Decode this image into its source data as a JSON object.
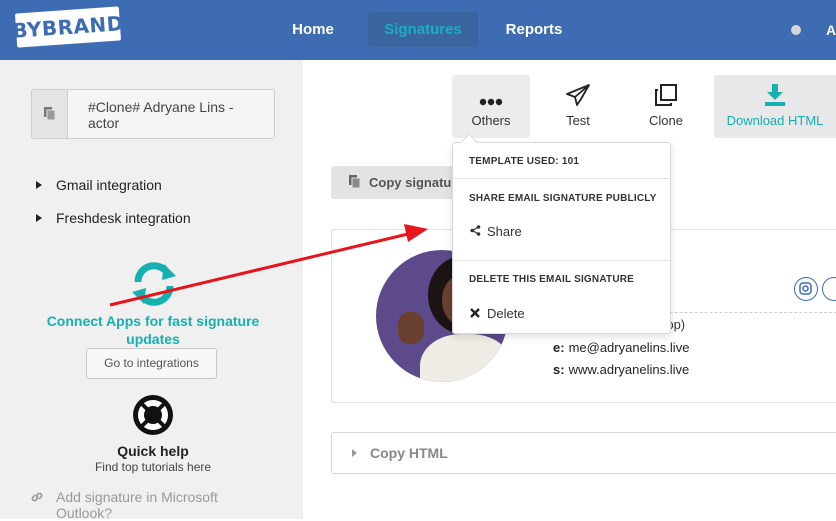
{
  "header": {
    "logo": "BYBRAND",
    "nav": [
      "Home",
      "Signatures",
      "Reports"
    ],
    "user_initial": "A"
  },
  "sidebar": {
    "selected_signature": "#Clone# Adryane Lins - actor",
    "integrations": [
      "Gmail integration",
      "Freshdesk integration"
    ],
    "connect_text": "Connect Apps for fast signature updates",
    "goto_button": "Go to integrations",
    "help_title": "Quick help",
    "help_sub": "Find top tutorials here",
    "outlook_text": "Add signature in Microsoft Outlook?"
  },
  "toolbar": {
    "others": "Others",
    "test": "Test",
    "clone": "Clone",
    "download": "Download HTML"
  },
  "main": {
    "copy_button": "Copy signature",
    "whatsapp_fragment": "tsapp)",
    "email_label": "e:",
    "email": "me@adryanelins.live",
    "site_label": "s:",
    "site": "www.adryanelins.live",
    "copy_html": "Copy HTML"
  },
  "dropdown": {
    "template_used": "TEMPLATE USED: 101",
    "share_heading": "SHARE EMAIL SIGNATURE PUBLICLY",
    "share": "Share",
    "delete_heading": "DELETE THIS EMAIL SIGNATURE",
    "delete": "Delete"
  },
  "colors": {
    "header_bg": "#3d6cb3",
    "accent_teal": "#17b0b0",
    "annotation_arrow": "#e8141b"
  },
  "icons": {
    "sig_select": "copy-icon",
    "connect": "sync-icon",
    "help": "lifebuoy-icon",
    "outlook": "link-icon",
    "others": "dots-icon",
    "test": "paper-plane-icon",
    "clone": "clone-icon",
    "download": "download-icon",
    "share": "share-icon",
    "delete": "close-icon"
  }
}
